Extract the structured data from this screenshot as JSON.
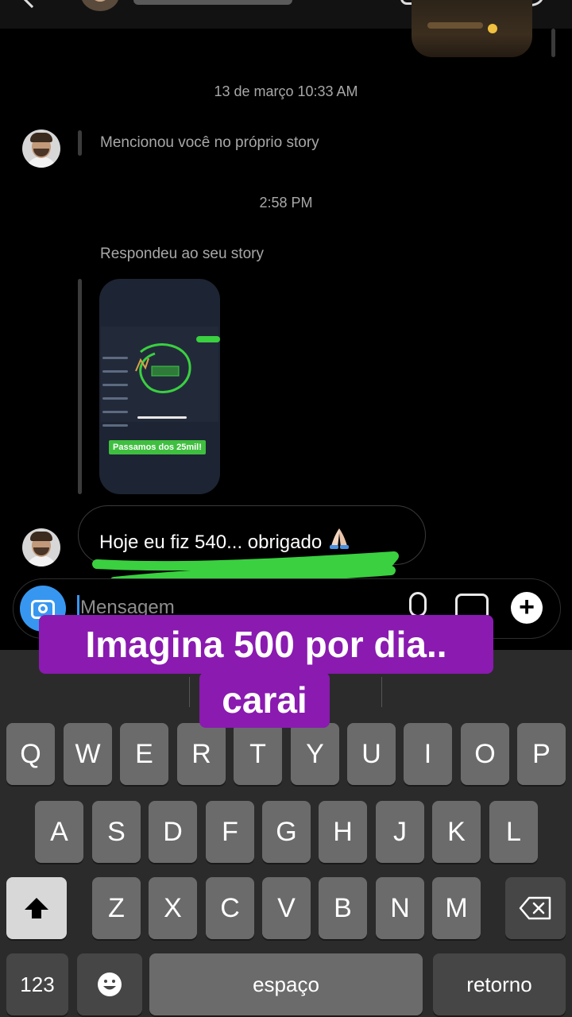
{
  "chat": {
    "timestamp_1": "13 de março 10:33 AM",
    "mention_text": "Mencionou você no próprio story",
    "timestamp_2": "2:58 PM",
    "reply_label": "Respondeu ao seu story",
    "story_banner": "Passamos dos 25mil!",
    "message_text": "Hoje eu fiz 540... obrigado"
  },
  "composer": {
    "placeholder": "Mensagem"
  },
  "caption": {
    "line1": "Imagina 500 por dia..",
    "line2": "carai"
  },
  "keyboard": {
    "row1": [
      "Q",
      "W",
      "E",
      "R",
      "T",
      "Y",
      "U",
      "I",
      "O",
      "P"
    ],
    "row2": [
      "A",
      "S",
      "D",
      "F",
      "G",
      "H",
      "J",
      "K",
      "L"
    ],
    "row3": [
      "Z",
      "X",
      "C",
      "V",
      "B",
      "N",
      "M"
    ],
    "numbers_label": "123",
    "space_label": "espaço",
    "return_label": "retorno"
  },
  "icons": {
    "back": "back-chevron-icon",
    "camera": "camera-icon",
    "mic": "microphone-icon",
    "gallery": "gallery-icon",
    "plus": "plus-icon",
    "shift": "shift-icon",
    "backspace": "backspace-icon",
    "emoji": "emoji-icon",
    "pray": "folded-hands-emoji"
  },
  "colors": {
    "accent_blue": "#3797f0",
    "caption_purple": "#8a1ab0",
    "scribble_green": "#3ad040"
  }
}
